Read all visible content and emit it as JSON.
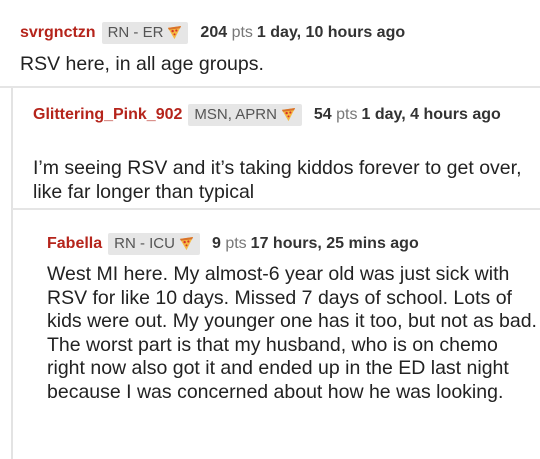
{
  "comments": [
    {
      "username": "svrgnctzn",
      "flair": "RN - ER",
      "flair_icon": "pizza-icon",
      "points": "204",
      "points_unit": "pts",
      "time": "1 day, 10 hours ago",
      "body": "RSV here, in all age groups."
    },
    {
      "username": "Glittering_Pink_902",
      "flair": "MSN, APRN",
      "flair_icon": "pizza-icon",
      "points": "54",
      "points_unit": "pts",
      "time": "1 day, 4 hours ago",
      "body": "I’m seeing RSV and it’s taking kiddos forever to get over, like far longer than typical"
    },
    {
      "username": "Fabella",
      "flair": "RN - ICU",
      "flair_icon": "pizza-icon",
      "points": "9",
      "points_unit": "pts",
      "time": "17 hours, 25 mins ago",
      "body": "West MI here. My almost-6 year old was just sick with RSV for like 10 days. Missed 7 days of school. Lots of kids were out. My younger one has it too, but not as bad. The worst part is that my husband, who is on chemo right now also got it and ended up in the ED last night because I was concerned about how he was looking."
    }
  ],
  "colors": {
    "username": "#b5241b",
    "badge_bg": "#e6e6e6",
    "thread_line": "#e3e3e3"
  }
}
